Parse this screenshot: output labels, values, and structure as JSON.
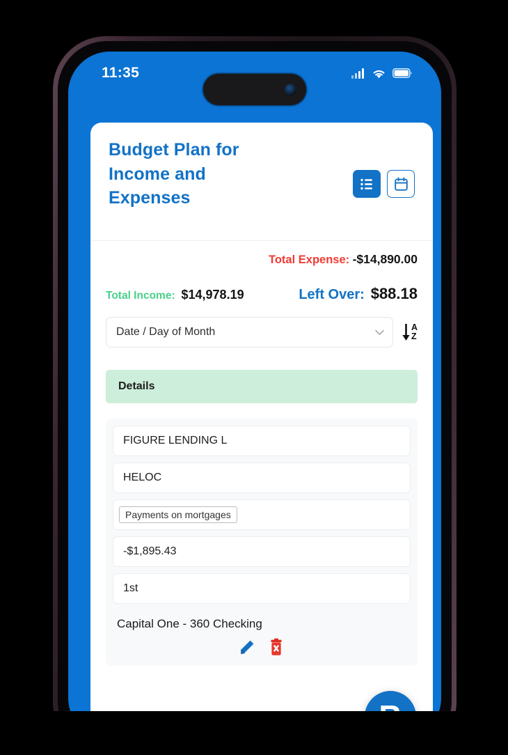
{
  "status_bar": {
    "time": "11:35",
    "icons": [
      "cellular-signal-icon",
      "wifi-icon",
      "battery-icon"
    ]
  },
  "app": {
    "title": "Budget Plan for Income and Expenses",
    "header_buttons": [
      {
        "name": "list-view-button",
        "icon": "list-icon",
        "style": "filled"
      },
      {
        "name": "calendar-view-button",
        "icon": "calendar-icon",
        "style": "outline"
      }
    ]
  },
  "totals": {
    "expense_label": "Total Expense:",
    "expense_value": "-$14,890.00",
    "income_label": "Total Income:",
    "income_value": "$14,978.19",
    "leftover_label": "Left Over:",
    "leftover_value": "$88.18"
  },
  "sort": {
    "selected": "Date / Day of Month",
    "sort_direction_icon": "sort-a-z-icon"
  },
  "details": {
    "section_header": "Details",
    "record": {
      "payee": "FIGURE LENDING L",
      "description": "HELOC",
      "category": "Payments on mortgages",
      "amount": "-$1,895.43",
      "day": "1st",
      "account": "Capital One - 360 Checking",
      "actions": [
        {
          "name": "edit-record-button",
          "icon": "pencil-icon"
        },
        {
          "name": "delete-record-button",
          "icon": "trash-delete-icon"
        }
      ]
    }
  },
  "fab": {
    "label": "B"
  },
  "colors": {
    "brand_blue": "#1272c6",
    "screen_blue": "#0b74d4",
    "expense_red": "#f03c35",
    "income_green": "#4ad08a",
    "details_green_bg": "#cdeedb",
    "delete_red": "#e02b20"
  }
}
